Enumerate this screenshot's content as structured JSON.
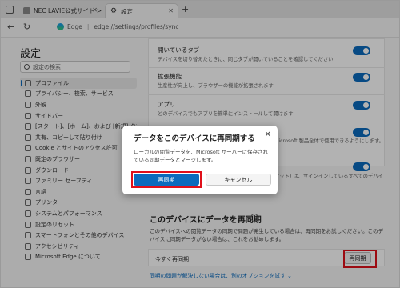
{
  "tabs": [
    {
      "label": "NEC LAVIE公式サイト > サービス&"
    },
    {
      "label": "設定"
    }
  ],
  "address": {
    "scheme": "Edge",
    "url": "edge://settings/profiles/sync"
  },
  "sidebar": {
    "title": "設定",
    "search_placeholder": "設定の検索",
    "items": [
      {
        "label": "プロファイル",
        "icon": "person-icon"
      },
      {
        "label": "プライバシー、検索、サービス",
        "icon": "lock-icon"
      },
      {
        "label": "外観",
        "icon": "appearance-icon"
      },
      {
        "label": "サイドバー",
        "icon": "sidebar-icon"
      },
      {
        "label": "[スタート]、[ホーム]、および [新規] タブ",
        "icon": "home-icon"
      },
      {
        "label": "共有、コピーして貼り付け",
        "icon": "share-icon"
      },
      {
        "label": "Cookie とサイトのアクセス許可",
        "icon": "cookie-icon"
      },
      {
        "label": "既定のブラウザー",
        "icon": "browser-icon"
      },
      {
        "label": "ダウンロード",
        "icon": "download-icon"
      },
      {
        "label": "ファミリー セーフティ",
        "icon": "family-icon"
      },
      {
        "label": "言語",
        "icon": "language-icon"
      },
      {
        "label": "プリンター",
        "icon": "printer-icon"
      },
      {
        "label": "システムとパフォーマンス",
        "icon": "system-icon"
      },
      {
        "label": "設定のリセット",
        "icon": "reset-icon"
      },
      {
        "label": "スマートフォンとその他のデバイス",
        "icon": "phone-icon"
      },
      {
        "label": "アクセシビリティ",
        "icon": "accessibility-icon"
      },
      {
        "label": "Microsoft Edge について",
        "icon": "edge-icon"
      }
    ]
  },
  "settings_rows": [
    {
      "title": "開いているタブ",
      "desc": "デバイスを切り替えたときに、同じタブが開いていることを確認してください"
    },
    {
      "title": "拡張機能",
      "desc": "生産性が向上し、ブラウザーの機能が拡張されます"
    },
    {
      "title": "アプリ",
      "desc": "どのデバイスでもアプリを簡単にインストールして開けます"
    }
  ],
  "partial_text": {
    "right1": "Microsoft 製品全体で使用できるようにします。",
    "right2": "ケット) は、サインインしているすべてのデバイ"
  },
  "resync_section": {
    "title": "このデバイスにデータを再同期",
    "help": "?",
    "desc": "このデバイスへの閲覧データの同期で問題が発生している場合は、再同期をお試しください。このデバイスに同期データがない場合は、これをお勧めします。",
    "row_label": "今すぐ再同期",
    "button": "再同期",
    "link": "同期の問題が解決しない場合は、別のオプションを試す ⌄"
  },
  "dialog": {
    "title": "データをこのデバイスに再同期する",
    "body": "ローカルの閲覧データを、Microsoft サーバーに保存されている同期データとマージします。",
    "confirm": "再同期",
    "cancel": "キャンセル"
  },
  "colors": {
    "accent": "#0b6bbd",
    "highlight": "#e0101a"
  }
}
